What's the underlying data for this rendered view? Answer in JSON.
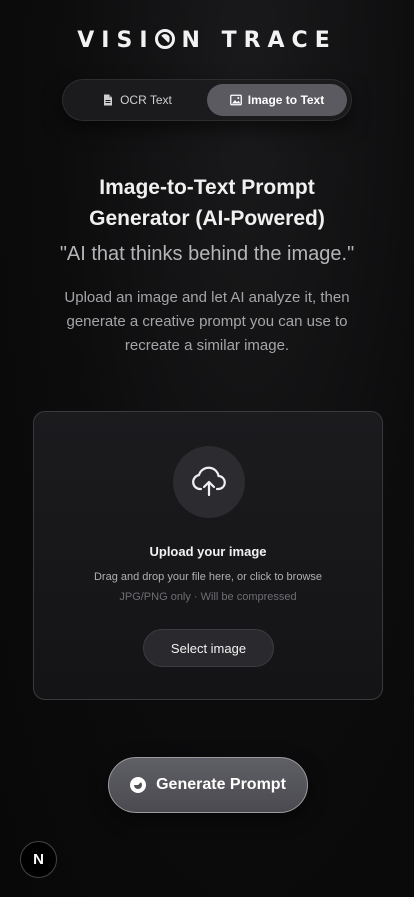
{
  "brand": {
    "before": "VISI",
    "after": "N TRACE"
  },
  "tabs": [
    {
      "label": "OCR Text",
      "icon": "document-icon",
      "active": false
    },
    {
      "label": "Image to Text",
      "icon": "image-icon",
      "active": true
    }
  ],
  "hero": {
    "title_line1": "Image-to-Text Prompt",
    "title_line2": "Generator (AI-Powered)",
    "quote": "\"AI that thinks behind the image.\"",
    "description": "Upload an image and let AI analyze it, then generate a creative prompt you can use to recreate a similar image."
  },
  "upload": {
    "icon": "cloud-upload-icon",
    "title": "Upload your image",
    "subtitle": "Drag and drop your file here, or click to browse",
    "note": "JPG/PNG only · Will be compressed",
    "button_label": "Select image"
  },
  "generate": {
    "label": "Generate Prompt",
    "icon": "spinner-icon"
  },
  "badge": {
    "label": "N"
  },
  "colors": {
    "background": "#0c0c0d",
    "active_tab": "#5a5a60",
    "generate_button": "#55555b"
  }
}
